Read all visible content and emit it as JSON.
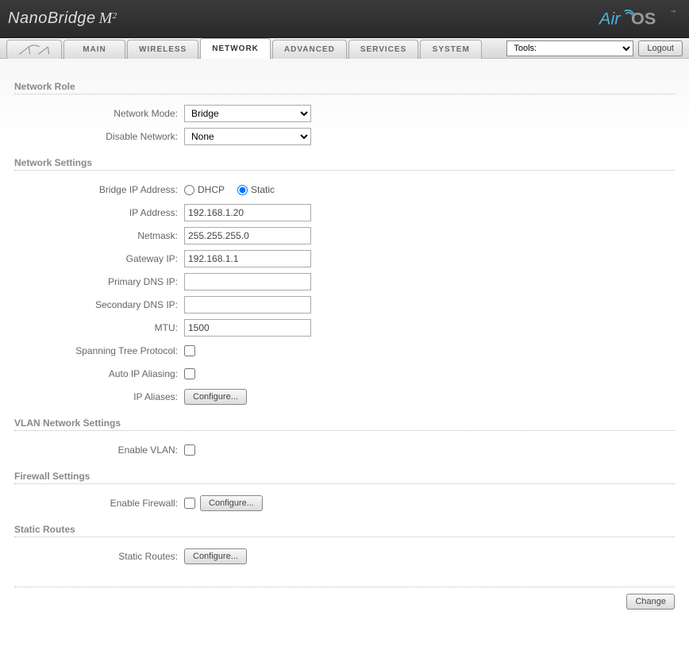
{
  "brand": {
    "name": "NanoBridge",
    "model": "M",
    "sup": "2"
  },
  "logo": {
    "air": "Air",
    "os": "OS",
    "tm": "™"
  },
  "nav": {
    "tabs": [
      "MAIN",
      "WIRELESS",
      "NETWORK",
      "ADVANCED",
      "SERVICES",
      "SYSTEM"
    ],
    "active": "NETWORK",
    "tools_label": "Tools:",
    "logout": "Logout"
  },
  "sections": {
    "role": {
      "title": "Network Role",
      "network_mode_label": "Network Mode:",
      "network_mode_value": "Bridge",
      "disable_network_label": "Disable Network:",
      "disable_network_value": "None"
    },
    "settings": {
      "title": "Network Settings",
      "bridge_ip_label": "Bridge IP Address:",
      "dhcp": "DHCP",
      "static": "Static",
      "ip_label": "IP Address:",
      "ip_value": "192.168.1.20",
      "netmask_label": "Netmask:",
      "netmask_value": "255.255.255.0",
      "gateway_label": "Gateway IP:",
      "gateway_value": "192.168.1.1",
      "primary_dns_label": "Primary DNS IP:",
      "primary_dns_value": "",
      "secondary_dns_label": "Secondary DNS IP:",
      "secondary_dns_value": "",
      "mtu_label": "MTU:",
      "mtu_value": "1500",
      "stp_label": "Spanning Tree Protocol:",
      "autoip_label": "Auto IP Aliasing:",
      "aliases_label": "IP Aliases:",
      "configure": "Configure..."
    },
    "vlan": {
      "title": "VLAN Network Settings",
      "enable_label": "Enable VLAN:"
    },
    "firewall": {
      "title": "Firewall Settings",
      "enable_label": "Enable Firewall:",
      "configure": "Configure..."
    },
    "routes": {
      "title": "Static Routes",
      "label": "Static Routes:",
      "configure": "Configure..."
    }
  },
  "footer": {
    "change": "Change"
  }
}
